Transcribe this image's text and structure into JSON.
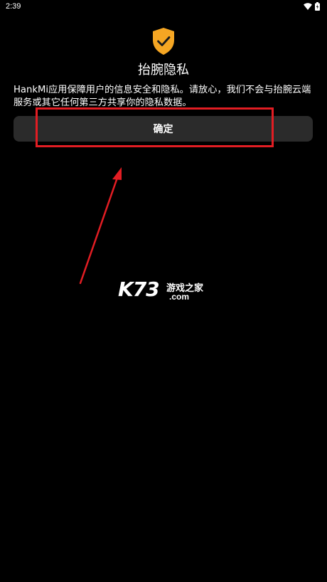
{
  "status_bar": {
    "time": "2:39",
    "icons": [
      "wifi-icon",
      "battery-icon"
    ]
  },
  "dialog": {
    "icon": "shield-check-icon",
    "icon_color": "#F5A623",
    "title": "抬腕隐私",
    "description": "HankMi应用保障用户的信息安全和隐私。请放心，我们不会与抬腕云端服务或其它任何第三方共享你的隐私数据。",
    "confirm_label": "确定"
  },
  "annotation": {
    "color": "#E21D23"
  },
  "watermark": {
    "brand": "K73",
    "site_name": "游戏之家",
    "domain": ".com"
  }
}
